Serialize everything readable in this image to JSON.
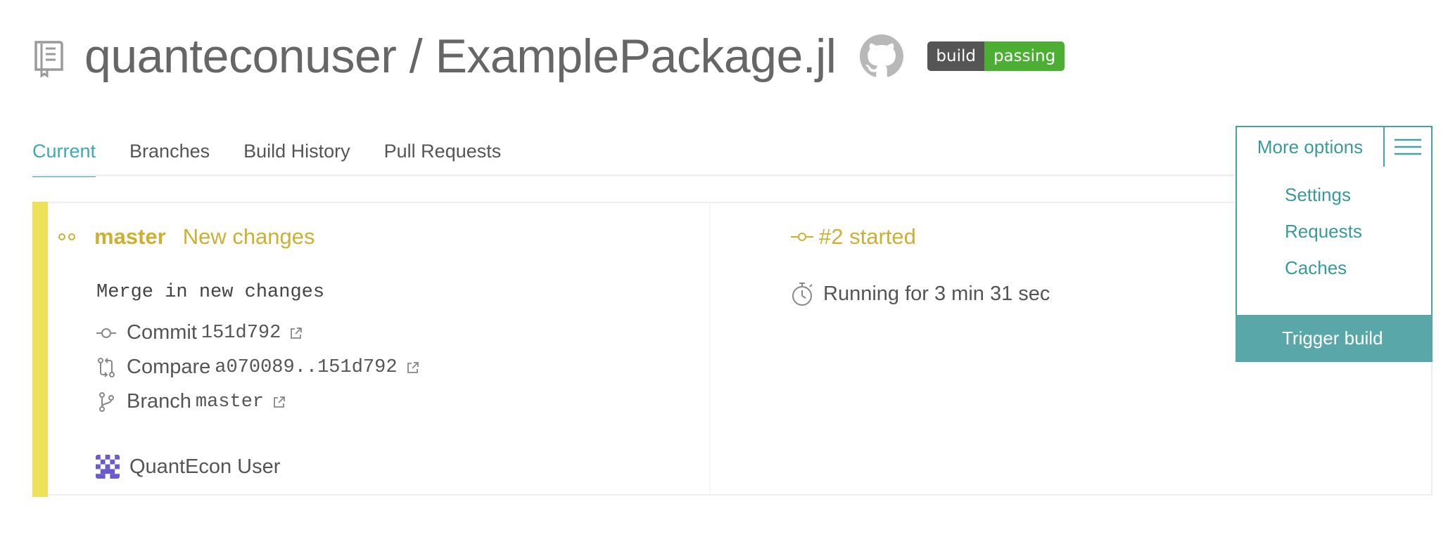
{
  "header": {
    "title": "quanteconuser / ExamplePackage.jl",
    "badge": {
      "left": "build",
      "right": "passing"
    },
    "icons": [
      "repo-icon",
      "github-icon"
    ]
  },
  "tabs": [
    {
      "label": "Current",
      "active": true
    },
    {
      "label": "Branches",
      "active": false
    },
    {
      "label": "Build History",
      "active": false
    },
    {
      "label": "Pull Requests",
      "active": false
    }
  ],
  "more_options": {
    "label": "More options",
    "items": [
      "Settings",
      "Requests",
      "Caches",
      "Trigger build"
    ]
  },
  "build": {
    "branch": "master",
    "status": "New changes",
    "message": "Merge in new changes",
    "commit_label": "Commit",
    "commit_hash": "151d792",
    "compare_label": "Compare",
    "compare_range": "a070089..151d792",
    "branch_label": "Branch",
    "branch_value": "master",
    "author": "QuantEcon User",
    "number": "#2 started",
    "duration": "Running for 3 min 31 sec"
  },
  "colors": {
    "accent": "#39aaa8",
    "state_started": "#cdb032",
    "stripe": "#ede15a",
    "badge_pass": "#4caf34",
    "badge_label": "#555555"
  }
}
